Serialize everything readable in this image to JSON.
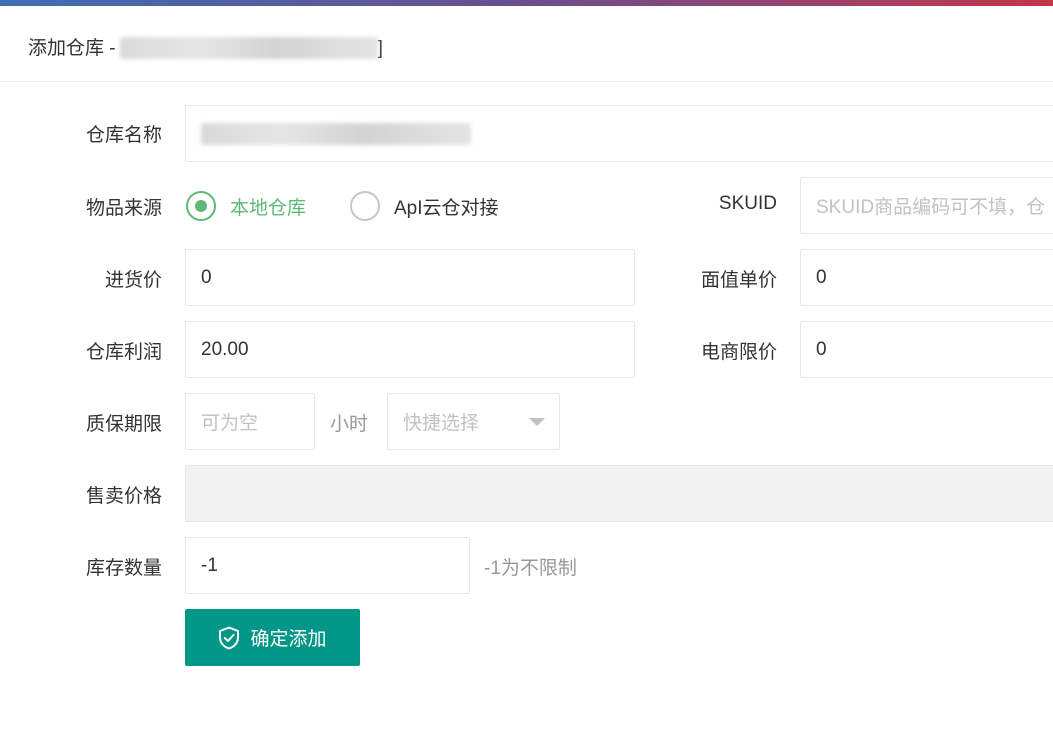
{
  "header": {
    "title_prefix": "添加仓库 -",
    "title_suffix": "]"
  },
  "form": {
    "warehouse_name": {
      "label": "仓库名称",
      "value": ""
    },
    "item_source": {
      "label": "物品来源",
      "options": [
        {
          "label": "本地仓库",
          "selected": true
        },
        {
          "label": "ApI云仓对接",
          "selected": false
        }
      ]
    },
    "skuid": {
      "label": "SKUID",
      "placeholder": "SKUID商品编码可不填，仓"
    },
    "purchase_price": {
      "label": "进货价",
      "value": "0"
    },
    "face_value": {
      "label": "面值单价",
      "value": "0"
    },
    "profit": {
      "label": "仓库利润",
      "value": "20.00"
    },
    "ecommerce_limit": {
      "label": "电商限价",
      "value": "0"
    },
    "warranty": {
      "label": "质保期限",
      "placeholder": "可为空",
      "unit": "小时",
      "quick_select": "快捷选择"
    },
    "sale_price": {
      "label": "售卖价格",
      "value": ""
    },
    "stock": {
      "label": "库存数量",
      "value": "-1",
      "hint": "-1为不限制"
    },
    "submit_label": "确定添加"
  },
  "colors": {
    "primary": "#009688",
    "radio_active": "#5fb878"
  }
}
